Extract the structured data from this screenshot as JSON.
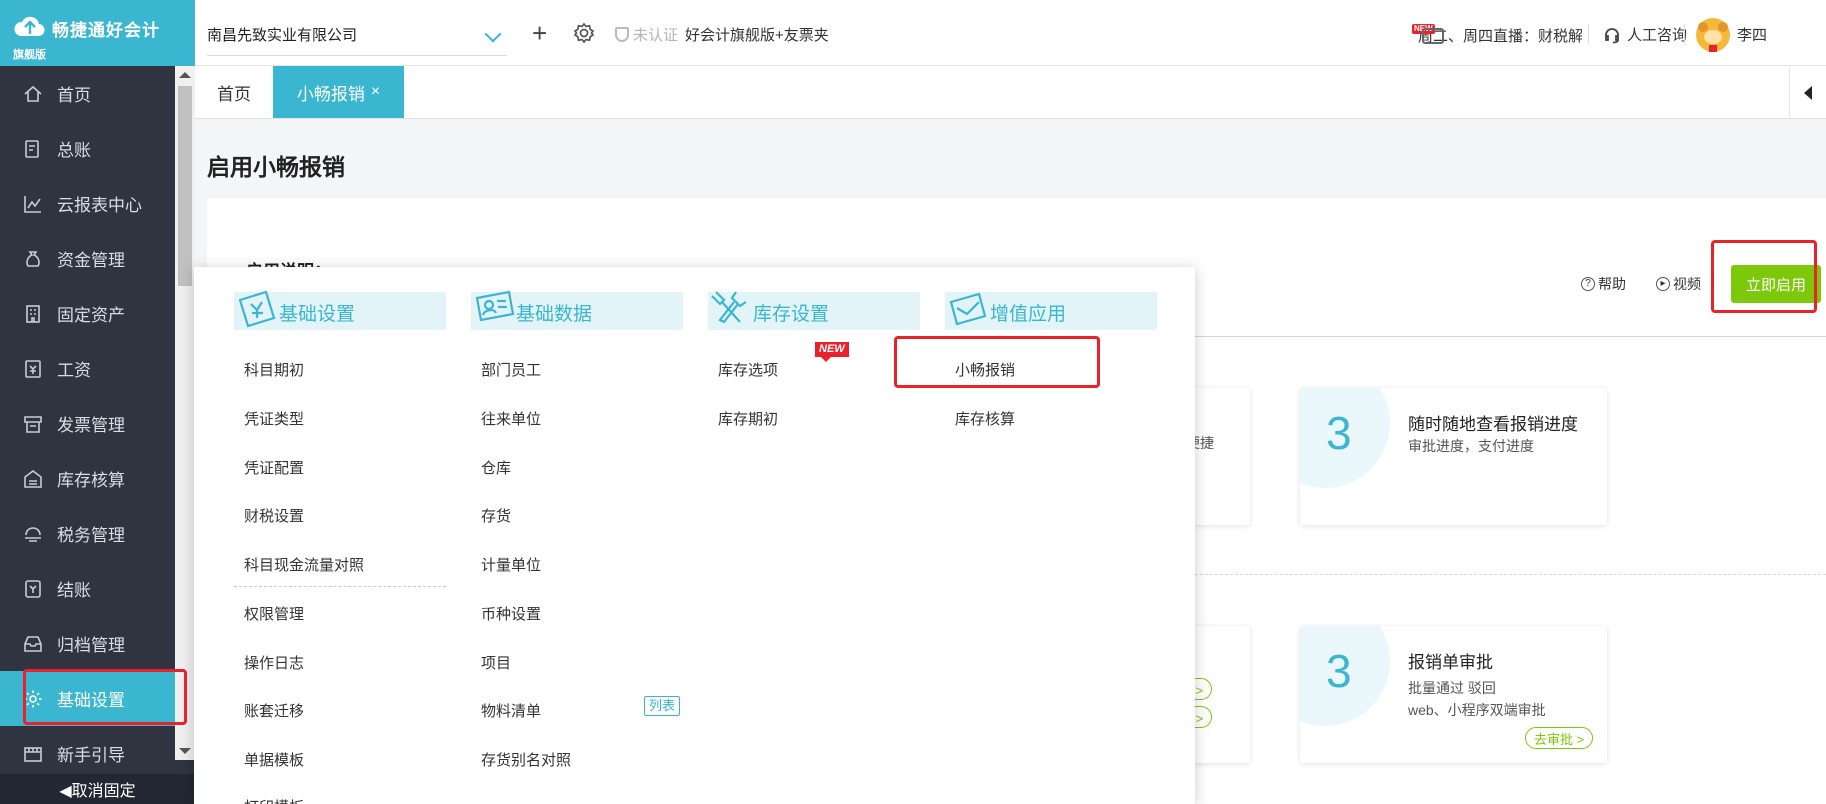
{
  "brand": {
    "name": "畅捷通好会计",
    "edition": "旗舰版"
  },
  "sidebar": {
    "items": [
      {
        "label": "首页",
        "icon": "home-icon"
      },
      {
        "label": "总账",
        "icon": "ledger-icon"
      },
      {
        "label": "云报表中心",
        "icon": "chart-icon"
      },
      {
        "label": "资金管理",
        "icon": "money-bag-icon"
      },
      {
        "label": "固定资产",
        "icon": "building-icon"
      },
      {
        "label": "工资",
        "icon": "salary-icon"
      },
      {
        "label": "发票管理",
        "icon": "invoice-icon"
      },
      {
        "label": "库存核算",
        "icon": "warehouse-icon"
      },
      {
        "label": "税务管理",
        "icon": "tax-icon"
      },
      {
        "label": "结账",
        "icon": "checkout-icon"
      },
      {
        "label": "归档管理",
        "icon": "archive-icon"
      },
      {
        "label": "基础设置",
        "icon": "gear-icon",
        "active": true
      },
      {
        "label": "新手引导",
        "icon": "guide-icon"
      }
    ],
    "unpin_label": "◀取消固定"
  },
  "topbar": {
    "company": "南昌先致实业有限公司",
    "cert_status": "未认证",
    "version": "好会计旗舰版+友票夹",
    "live_badge": "NEW",
    "live_text": "周二、周四直播：财税解",
    "consult": "人工咨询",
    "user": "李四"
  },
  "tabs": [
    {
      "label": "首页",
      "active": false
    },
    {
      "label": "小畅报销",
      "active": true,
      "close": "×"
    }
  ],
  "main": {
    "title": "启用小畅报销",
    "intro_label": "启用说明：",
    "help": "帮助",
    "video": "视频",
    "enable_button": "立即启用",
    "card_top_partial": "捷便捷",
    "card_top": {
      "num": "3",
      "title": "随时随地查看报销进度",
      "desc": "审批进度，支付进度"
    },
    "pill_partial_1": "置 >",
    "pill_partial_2": "置 >",
    "card_bottom": {
      "num": "3",
      "title": "报销单审批",
      "desc1": "批量通过 驳回",
      "desc2": "web、小程序双端审批",
      "action": "去审批 >"
    }
  },
  "menu": {
    "columns": [
      {
        "title": "基础设置",
        "icon": "settings-icon",
        "items": [
          "科目期初",
          "凭证类型",
          "凭证配置",
          "财税设置",
          "科目现金流量对照",
          "权限管理",
          "操作日志",
          "账套迁移",
          "单据模板",
          "打印模板"
        ]
      },
      {
        "title": "基础数据",
        "icon": "id-card-icon",
        "items": [
          "部门员工",
          "往来单位",
          "仓库",
          "存货",
          "计量单位",
          "币种设置",
          "项目",
          "物料清单",
          "存货别名对照"
        ],
        "tag": "列表"
      },
      {
        "title": "库存设置",
        "icon": "tools-icon",
        "items": [
          "库存选项",
          "库存期初"
        ]
      },
      {
        "title": "增值应用",
        "icon": "value-app-icon",
        "items": [
          "小畅报销",
          "库存核算"
        ],
        "badge": "NEW"
      }
    ]
  },
  "colors": {
    "accent": "#3ab6d1",
    "sidebar_bg": "#2f3440",
    "enable_green": "#7dc80a",
    "highlight_red": "#e8232c"
  }
}
